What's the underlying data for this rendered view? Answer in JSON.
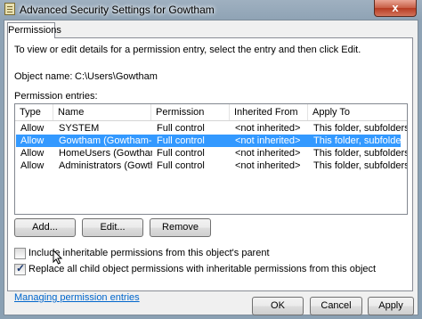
{
  "window": {
    "title": "Advanced Security Settings for Gowtham",
    "close_glyph": "x"
  },
  "tabs": [
    "Permissions"
  ],
  "instructions": "To view or edit details for a permission entry, select the entry and then click Edit.",
  "object_name_label": "Object name:",
  "object_name_value": "C:\\Users\\Gowtham",
  "permission_entries_label": "Permission entries:",
  "columns": [
    "Type",
    "Name",
    "Permission",
    "Inherited From",
    "Apply To"
  ],
  "rows": [
    {
      "type": "Allow",
      "name": "SYSTEM",
      "permission": "Full control",
      "inherited_from": "<not inherited>",
      "apply_to": "This folder, subfolders a...",
      "selected": false
    },
    {
      "type": "Allow",
      "name": "Gowtham (Gowtham-PC\\...",
      "permission": "Full control",
      "inherited_from": "<not inherited>",
      "apply_to": "This folder, subfolders a...",
      "selected": true
    },
    {
      "type": "Allow",
      "name": "HomeUsers (Gowtham-P...",
      "permission": "Full control",
      "inherited_from": "<not inherited>",
      "apply_to": "This folder, subfolders a...",
      "selected": false
    },
    {
      "type": "Allow",
      "name": "Administrators (Gowtha...",
      "permission": "Full control",
      "inherited_from": "<not inherited>",
      "apply_to": "This folder, subfolders a...",
      "selected": false
    }
  ],
  "buttons": {
    "add": "Add...",
    "edit": "Edit...",
    "remove": "Remove",
    "ok": "OK",
    "cancel": "Cancel",
    "apply": "Apply"
  },
  "checkboxes": {
    "include_inheritable": {
      "label": "Include inheritable permissions from this object's parent",
      "checked": false
    },
    "replace_child": {
      "label": "Replace all child object permissions with inheritable permissions from this object",
      "checked": true
    }
  },
  "link": "Managing permission entries",
  "colors": {
    "selection": "#3399ff",
    "link": "#0066cc",
    "title_bar": "#9fb0c0"
  },
  "icons": [
    "document-icon",
    "close-icon",
    "checkbox-check-icon",
    "mouse-cursor-icon"
  ]
}
